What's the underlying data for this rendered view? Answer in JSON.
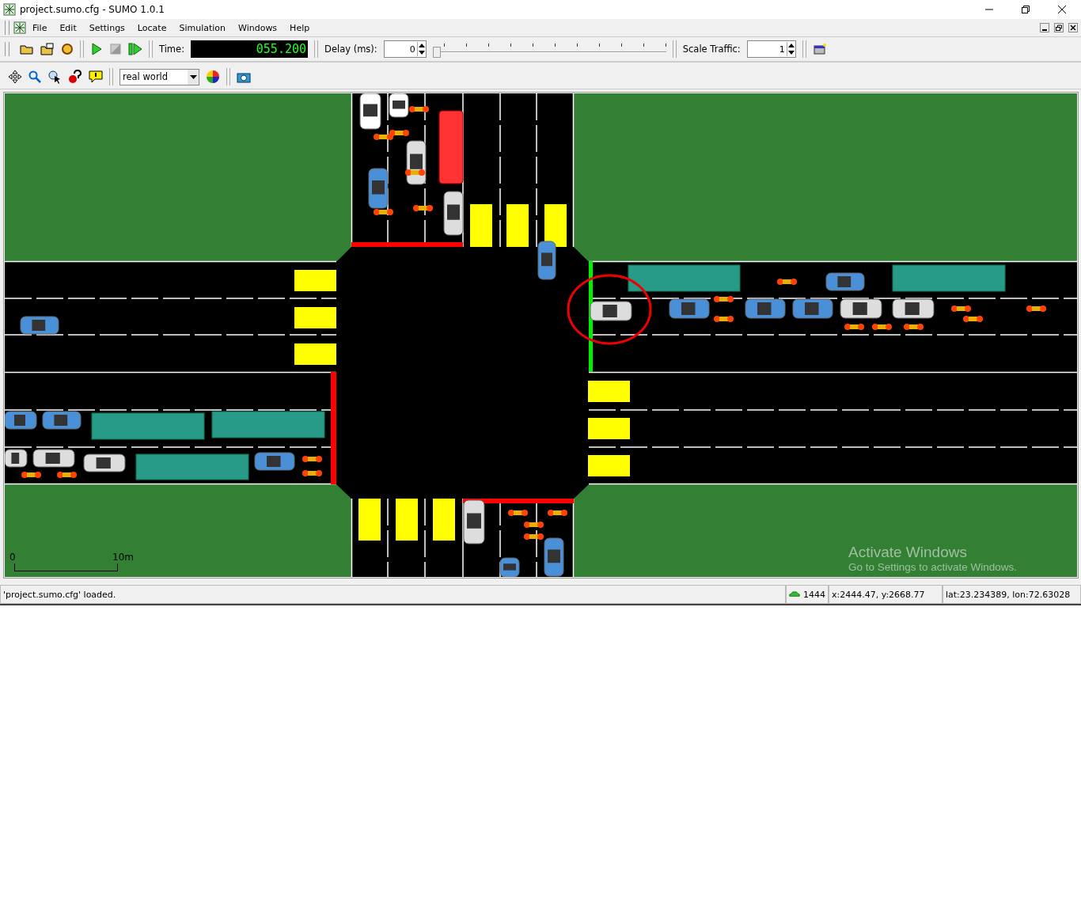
{
  "window": {
    "title": "project.sumo.cfg - SUMO 1.0.1"
  },
  "menu": [
    "File",
    "Edit",
    "Settings",
    "Locate",
    "Simulation",
    "Windows",
    "Help"
  ],
  "toolbar": {
    "time_label": "Time:",
    "time_value": "055.200",
    "delay_label": "Delay (ms):",
    "delay_value": "0",
    "delay_slider": {
      "level": 0
    },
    "scale_label": "Scale Traffic:",
    "scale_value": "1"
  },
  "view_toolbar": {
    "scheme": "real world"
  },
  "map": {
    "scale_start": "0",
    "scale_end": "10m",
    "overlay_title": "Activate Windows",
    "overlay_text": "Go to Settings to activate Windows."
  },
  "status_bar": {
    "message": "'project.sumo.cfg' loaded.",
    "vehicle_count": "1444",
    "position": "x:2444.47, y:2668.77",
    "geo": "lat:23.234389, lon:72.63028"
  }
}
